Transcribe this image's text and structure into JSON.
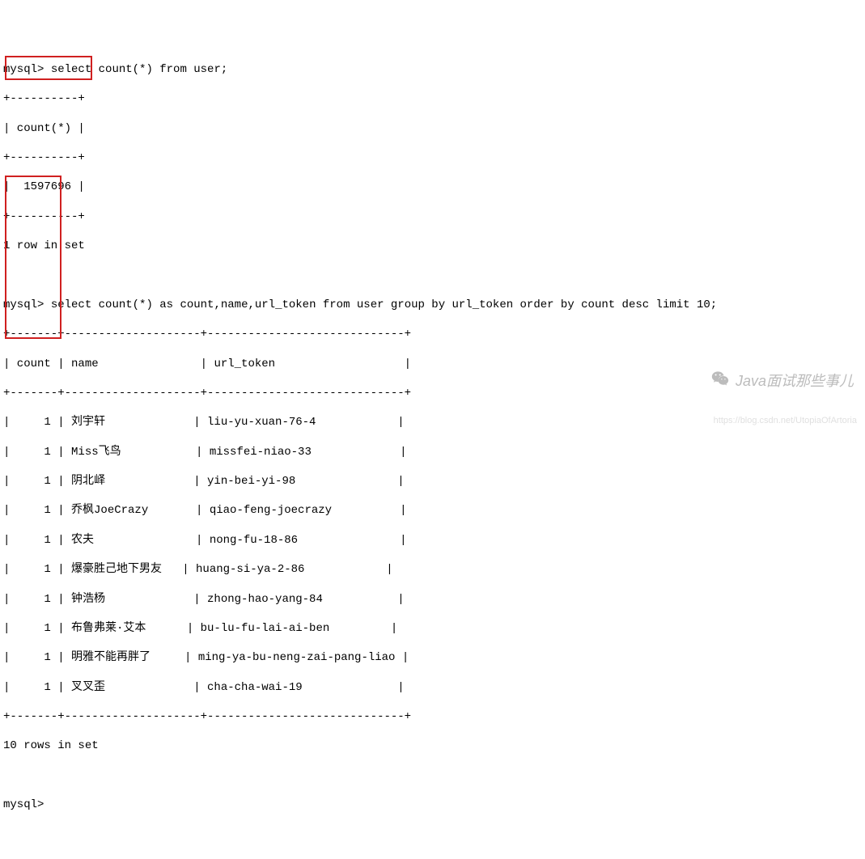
{
  "prompt": "mysql>",
  "query1": "select count(*) from user;",
  "border1_top": "+----------+",
  "header1": "| count(*) |",
  "border1_mid": "+----------+",
  "result1_row": "|  1597696 |",
  "border1_bot": "+----------+",
  "summary1": "1 row in set",
  "query2": "select count(*) as count,name,url_token from user group by url_token order by count desc limit 10;",
  "border2_top": "+-------+--------------------+-----------------------------+",
  "header2": "| count | name               | url_token                   |",
  "border2_mid": "+-------+--------------------+-----------------------------+",
  "rows2": [
    "|     1 | 刘宇轩             | liu-yu-xuan-76-4            |",
    "|     1 | Miss飞鸟           | missfei-niao-33             |",
    "|     1 | 阴北峄             | yin-bei-yi-98               |",
    "|     1 | 乔枫JoeCrazy       | qiao-feng-joecrazy          |",
    "|     1 | 农夫               | nong-fu-18-86               |",
    "|     1 | 爆豪胜己地下男友   | huang-si-ya-2-86            |",
    "|     1 | 钟浩杨             | zhong-hao-yang-84           |",
    "|     1 | 布鲁弗莱·艾本      | bu-lu-fu-lai-ai-ben         |",
    "|     1 | 明雅不能再胖了     | ming-ya-bu-neng-zai-pang-liao |",
    "|     1 | 叉叉歪             | cha-cha-wai-19              |"
  ],
  "border2_bot": "+-------+--------------------+-----------------------------+",
  "summary2": "10 rows in set",
  "watermark_text": "Java面试那些事儿",
  "sub_watermark": "https://blog.csdn.net/UtopiaOfArtoria",
  "chart_data": {
    "type": "table",
    "query1": {
      "columns": [
        "count(*)"
      ],
      "rows": [
        [
          1597696
        ]
      ],
      "summary": "1 row in set"
    },
    "query2": {
      "columns": [
        "count",
        "name",
        "url_token"
      ],
      "rows": [
        [
          1,
          "刘宇轩",
          "liu-yu-xuan-76-4"
        ],
        [
          1,
          "Miss飞鸟",
          "missfei-niao-33"
        ],
        [
          1,
          "阴北峄",
          "yin-bei-yi-98"
        ],
        [
          1,
          "乔枫JoeCrazy",
          "qiao-feng-joecrazy"
        ],
        [
          1,
          "农夫",
          "nong-fu-18-86"
        ],
        [
          1,
          "爆豪胜己地下男友",
          "huang-si-ya-2-86"
        ],
        [
          1,
          "钟浩杨",
          "zhong-hao-yang-84"
        ],
        [
          1,
          "布鲁弗莱·艾本",
          "bu-lu-fu-lai-ai-ben"
        ],
        [
          1,
          "明雅不能再胖了",
          "ming-ya-bu-neng-zai-pang-liao"
        ],
        [
          1,
          "叉叉歪",
          "cha-cha-wai-19"
        ]
      ],
      "summary": "10 rows in set"
    }
  }
}
